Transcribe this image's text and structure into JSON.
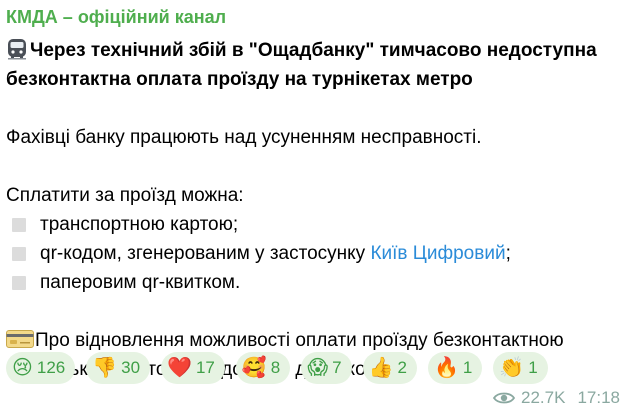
{
  "channel": {
    "name": "КМДА – офіційний канал"
  },
  "post": {
    "headline": "Через технічний збій в \"Ощадбанку\" тимчасово недоступна безконтактна оплата проїзду на турнікетах метро",
    "headline_icon": "metro-train-icon",
    "para1": "Фахівці банку працюють над усуненням несправності.",
    "pay_intro": "Сплатити за проїзд можна:",
    "list": [
      {
        "text": "транспортною картою;"
      },
      {
        "text_before": "qr-кодом, згенерованим у застосунку ",
        "link": "Київ Цифровий",
        "text_after": ";"
      },
      {
        "text": "паперовим qr-квитком."
      }
    ],
    "final_icon": "credit-card-icon",
    "final": "Про відновлення можливості оплати проїзду безконтактною банківською картою повідомимо додатково."
  },
  "reactions": [
    {
      "emoji": "😢",
      "icon": "crying-face-icon",
      "count": "126"
    },
    {
      "emoji": "👎",
      "icon": "thumbs-down-icon",
      "count": "30"
    },
    {
      "emoji": "❤️",
      "icon": "red-heart-icon",
      "count": "17"
    },
    {
      "emoji": "🥰",
      "icon": "smiling-face-hearts-icon",
      "count": "8"
    },
    {
      "emoji": "😱",
      "icon": "screaming-face-icon",
      "count": "7"
    },
    {
      "emoji": "👍",
      "icon": "thumbs-up-icon",
      "count": "2"
    },
    {
      "emoji": "🔥",
      "icon": "fire-icon",
      "count": "1"
    },
    {
      "emoji": "👏",
      "icon": "clapping-hands-icon",
      "count": "1"
    }
  ],
  "meta": {
    "views": "22.7K",
    "time": "17:18"
  },
  "colors": {
    "channel": "#4fae4e",
    "link": "#2a8bd8",
    "reaction_bg": "#e6f3e2",
    "reaction_text": "#3f9f47",
    "meta": "#8aa8a0"
  }
}
